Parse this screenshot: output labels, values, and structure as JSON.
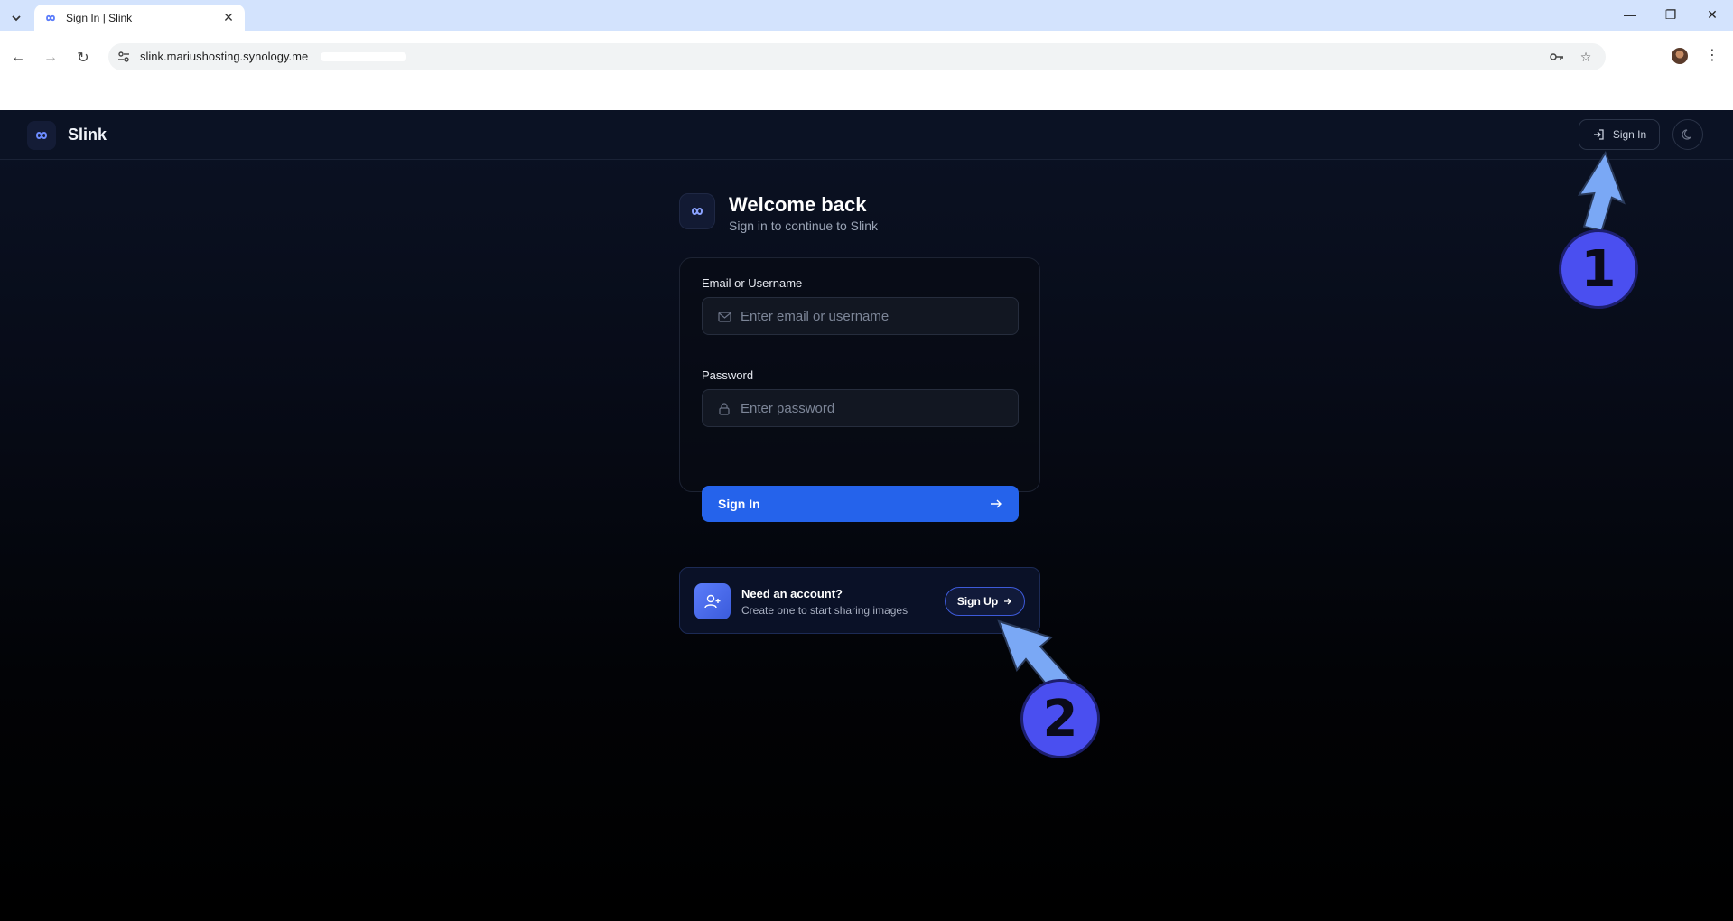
{
  "browser": {
    "tab_title": "Sign In | Slink",
    "url": "slink.mariushosting.synology.me"
  },
  "header": {
    "brand": "Slink",
    "signin_label": "Sign In"
  },
  "welcome": {
    "title": "Welcome back",
    "subtitle": "Sign in to continue to Slink"
  },
  "form": {
    "email_label": "Email or Username",
    "email_placeholder": "Enter email or username",
    "password_label": "Password",
    "password_placeholder": "Enter password",
    "submit_label": "Sign In"
  },
  "signup": {
    "title": "Need an account?",
    "subtitle": "Create one to start sharing images",
    "button_label": "Sign Up"
  },
  "annotations": {
    "badge1": "1",
    "badge2": "2"
  },
  "colors": {
    "accent": "#2563eb",
    "badge": "#4a4ff0",
    "arrow": "#7aa8f5"
  }
}
